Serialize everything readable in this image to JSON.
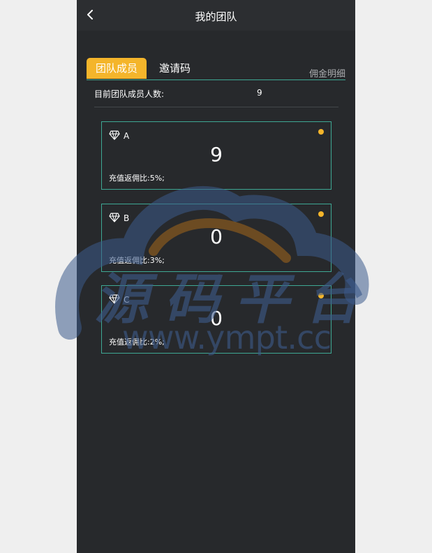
{
  "header": {
    "title": "我的团队",
    "back_icon": "chevron-left-icon"
  },
  "tabs": [
    {
      "label": "团队成员",
      "active": true
    },
    {
      "label": "邀请码",
      "active": false
    }
  ],
  "commission_link": "佣金明细",
  "team_count": {
    "label": "目前团队成员人数:",
    "value": "9"
  },
  "levels": [
    {
      "name": "A",
      "count": "9",
      "rebate": "充值返佣比:5%;"
    },
    {
      "name": "B",
      "count": "0",
      "rebate": "充值返佣比:3%;"
    },
    {
      "name": "C",
      "count": "0",
      "rebate": "充值返佣比:2%;"
    }
  ],
  "watermark": {
    "title": "源码平台",
    "url": "www.ympt.cc"
  },
  "colors": {
    "accent": "#f4b52b",
    "border": "#3ea894",
    "background": "#27292c"
  }
}
